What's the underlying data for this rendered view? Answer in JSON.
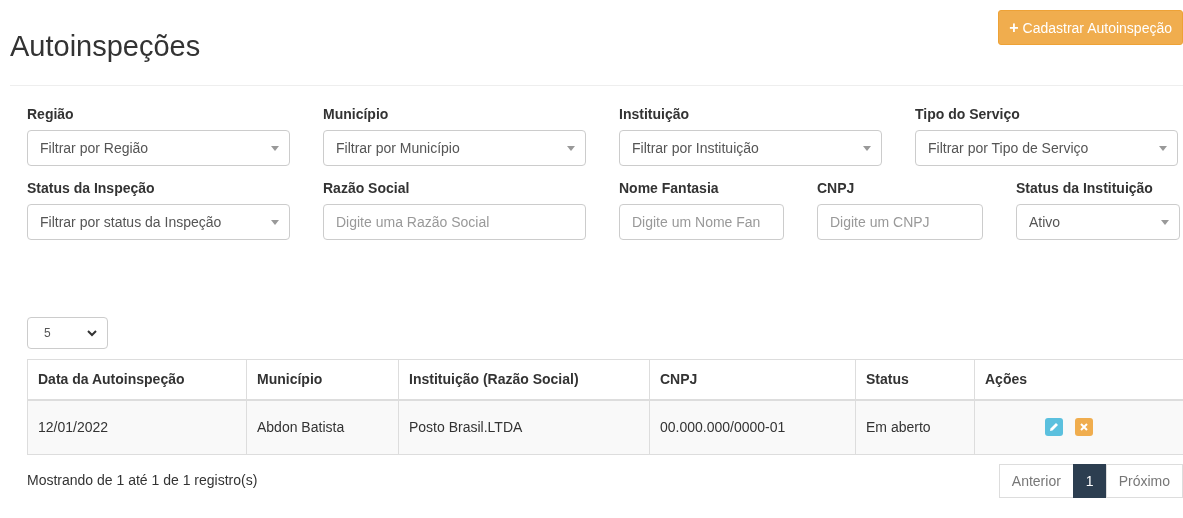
{
  "page": {
    "title": "Autoinspeções",
    "add_button": {
      "icon": "+",
      "label": "Cadastrar Autoinspeção"
    }
  },
  "filter_rows": [
    {
      "fields": [
        {
          "kind": "select",
          "label": "Região",
          "value": "Filtrar por Região"
        },
        {
          "kind": "select",
          "label": "Município",
          "value": "Filtrar por Município"
        },
        {
          "kind": "select",
          "label": "Instituição",
          "value": "Filtrar por Instituição"
        },
        {
          "kind": "select",
          "label": "Tipo do Serviço",
          "value": "Filtrar por Tipo de Serviço"
        }
      ]
    },
    {
      "fields": [
        {
          "kind": "select",
          "label": "Status da Inspeção",
          "value": "Filtrar por status da Inspeção"
        },
        {
          "kind": "input",
          "label": "Razão Social",
          "placeholder": "Digite uma Razão Social"
        },
        {
          "kind": "input",
          "label": "Nome Fantasia",
          "placeholder": "Digite um Nome Fan"
        },
        {
          "kind": "input",
          "label": "CNPJ",
          "placeholder": "Digite um CNPJ"
        },
        {
          "kind": "select",
          "label": "Status da Instituição",
          "value": "Ativo"
        }
      ]
    }
  ],
  "page_size": "5",
  "table": {
    "columns": [
      "Data da Autoinspeção",
      "Município",
      "Instituição (Razão Social)",
      "CNPJ",
      "Status",
      "Ações"
    ],
    "rows": [
      {
        "cells": [
          "12/01/2022",
          "Abdon Batista",
          "Posto Brasil.LTDA",
          "00.000.000/0000-01",
          "Em aberto"
        ],
        "actions": [
          {
            "kind": "edit"
          },
          {
            "kind": "delete"
          }
        ]
      }
    ]
  },
  "summary": "Mostrando de 1 até 1 de 1 registro(s)",
  "pagination": [
    {
      "label": "Anterior",
      "selected": false
    },
    {
      "label": "1",
      "selected": true
    },
    {
      "label": "Próximo",
      "selected": false
    }
  ]
}
